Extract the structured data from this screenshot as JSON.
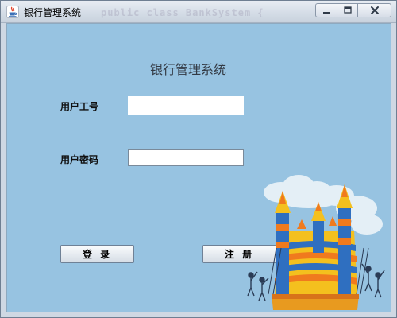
{
  "window": {
    "title": "银行管理系统",
    "background_code": "public class BankSystem {"
  },
  "form": {
    "heading": "银行管理系统",
    "user_id_label": "用户工号",
    "user_id_value": "",
    "password_label": "用户密码",
    "password_value": ""
  },
  "buttons": {
    "login_label": "登 录",
    "register_label": "注 册"
  },
  "colors": {
    "content_background": "#97c3e1",
    "titlebar": "#d5dde7"
  },
  "icons": {
    "app": "java-cup-icon",
    "minimize": "minimize-icon",
    "maximize": "maximize-icon",
    "close": "close-icon",
    "illustration": "bouncy-castle-illustration"
  }
}
